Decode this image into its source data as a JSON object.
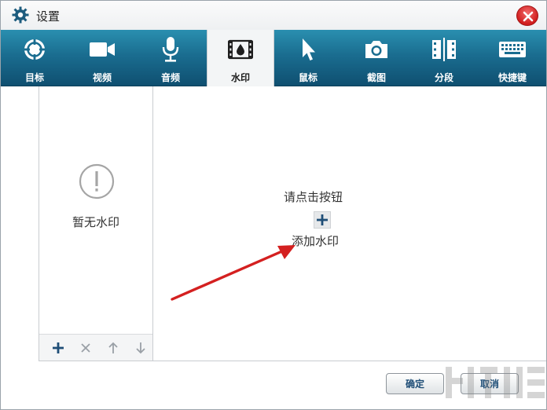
{
  "window": {
    "title": "设置"
  },
  "toolbar": {
    "items": [
      {
        "label": "目标",
        "icon": "target-icon"
      },
      {
        "label": "视频",
        "icon": "video-camera-icon"
      },
      {
        "label": "音频",
        "icon": "microphone-icon"
      },
      {
        "label": "水印",
        "icon": "watermark-film-icon",
        "active": true
      },
      {
        "label": "鼠标",
        "icon": "mouse-pointer-icon"
      },
      {
        "label": "截图",
        "icon": "camera-icon"
      },
      {
        "label": "分段",
        "icon": "segment-icon"
      },
      {
        "label": "快捷键",
        "icon": "keyboard-icon"
      }
    ]
  },
  "watermark_list": {
    "empty_text": "暂无水印",
    "actions": [
      "add-icon",
      "delete-icon",
      "move-up-icon",
      "move-down-icon"
    ]
  },
  "main": {
    "hint_line1": "请点击按钮",
    "hint_line2": "添加水印"
  },
  "footer": {
    "ok_label": "确定",
    "cancel_label": "取消"
  },
  "colors": {
    "toolbar_top": "#2a8fb0",
    "toolbar_bottom": "#0f4f70",
    "close_red": "#d01d1d",
    "arrow_red": "#d42020"
  }
}
